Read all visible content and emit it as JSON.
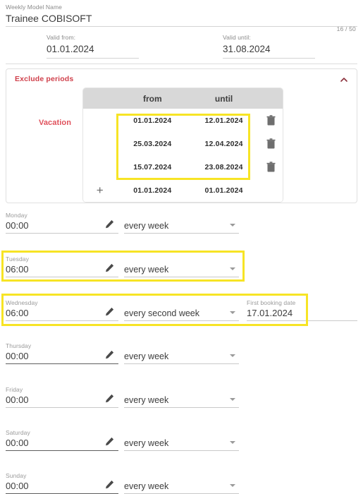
{
  "header": {
    "model_name_label": "Weekly Model Name",
    "model_name_value": "Trainee COBISOFT",
    "char_counter": "16 / 50",
    "valid_from_label": "Valid from:",
    "valid_from_value": "01.01.2024",
    "valid_until_label": "Valid until:",
    "valid_until_value": "31.08.2024"
  },
  "exclude_periods": {
    "title": "Exclude periods",
    "collapse_icon": "chevron-up-icon",
    "category_label": "Vacation",
    "columns": [
      "from",
      "until"
    ],
    "rows": [
      {
        "from": "01.01.2024",
        "until": "12.01.2024",
        "delete_icon": "trash-icon"
      },
      {
        "from": "25.03.2024",
        "until": "12.04.2024",
        "delete_icon": "trash-icon"
      },
      {
        "from": "15.07.2024",
        "until": "23.08.2024",
        "delete_icon": "trash-icon"
      }
    ],
    "new_row": {
      "add_icon": "plus-icon",
      "from": "01.01.2024",
      "until": "01.01.2024"
    }
  },
  "days": [
    {
      "label": "Monday",
      "time": "00:00",
      "edit_icon": "pencil-icon",
      "frequency": "every week",
      "caret_icon": "chevron-down-icon",
      "highlighted": false,
      "underline_dark": false
    },
    {
      "label": "Tuesday",
      "time": "06:00",
      "edit_icon": "pencil-icon",
      "frequency": "every week",
      "caret_icon": "chevron-down-icon",
      "highlighted": true,
      "underline_dark": false
    },
    {
      "label": "Wednesday",
      "time": "06:00",
      "edit_icon": "pencil-icon",
      "frequency": "every second week",
      "caret_icon": "chevron-down-icon",
      "highlighted": true,
      "underline_dark": false,
      "booking_label": "First booking date",
      "booking_value": "17.01.2024"
    },
    {
      "label": "Thursday",
      "time": "00:00",
      "edit_icon": "pencil-icon",
      "frequency": "every week",
      "caret_icon": "chevron-down-icon",
      "highlighted": false,
      "underline_dark": true
    },
    {
      "label": "Friday",
      "time": "00:00",
      "edit_icon": "pencil-icon",
      "frequency": "every week",
      "caret_icon": "chevron-down-icon",
      "highlighted": false,
      "underline_dark": false
    },
    {
      "label": "Saturday",
      "time": "00:00",
      "edit_icon": "pencil-icon",
      "frequency": "every week",
      "caret_icon": "chevron-down-icon",
      "highlighted": false,
      "underline_dark": true
    },
    {
      "label": "Sunday",
      "time": "00:00",
      "edit_icon": "pencil-icon",
      "frequency": "every week",
      "caret_icon": "chevron-down-icon",
      "highlighted": false,
      "underline_dark": true
    }
  ],
  "colors": {
    "accent_red": "#d0414c",
    "vacation_red": "#e0515c",
    "highlight_yellow": "#f7e425",
    "table_header_gray": "#d8d8d8"
  }
}
